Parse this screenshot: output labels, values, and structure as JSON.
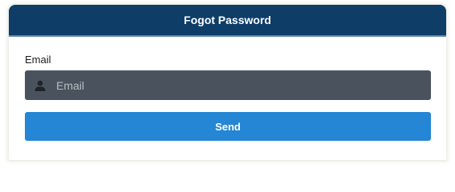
{
  "header": {
    "title": "Fogot Password"
  },
  "form": {
    "email_label": "Email",
    "email_placeholder": "Email",
    "email_value": "",
    "email_icon": "user-icon",
    "send_label": "Send"
  },
  "colors": {
    "header_bg": "#0e3d68",
    "input_bg": "#4a535d",
    "button_bg": "#2486d4"
  }
}
